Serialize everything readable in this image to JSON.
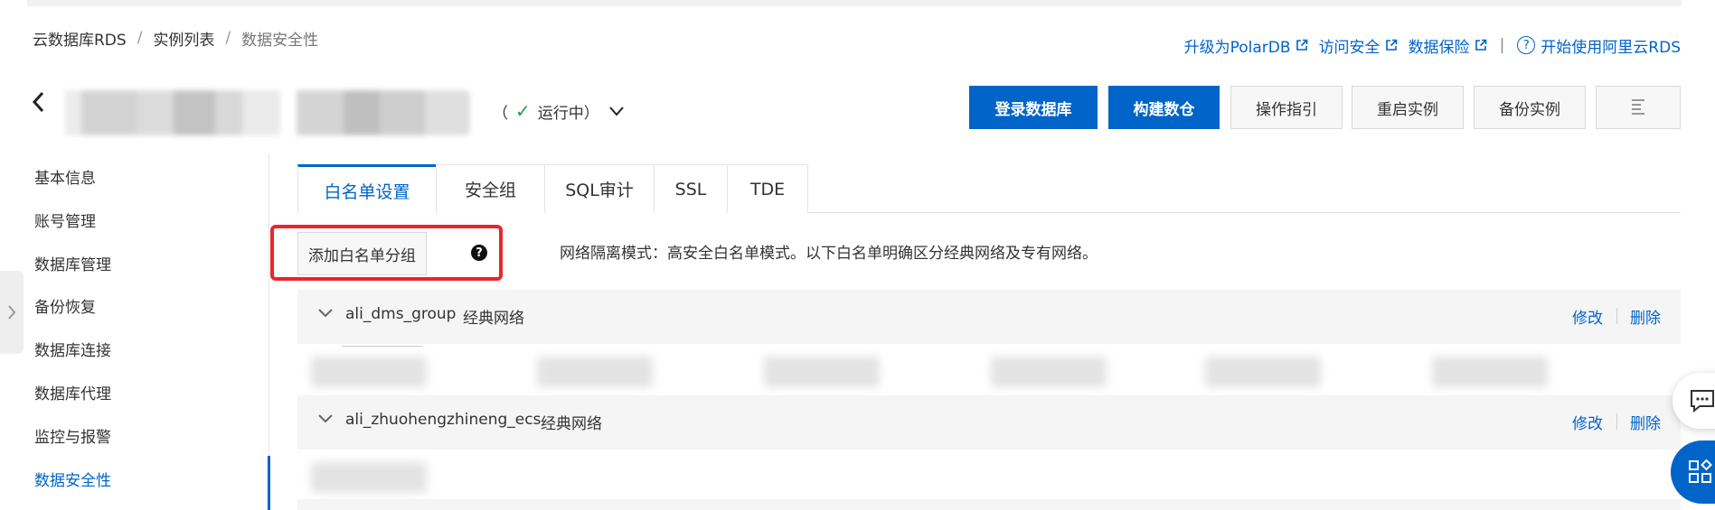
{
  "breadcrumb": {
    "items": [
      "云数据库RDS",
      "实例列表",
      "数据安全性"
    ],
    "separator": "/"
  },
  "top_links": {
    "upgrade": "升级为PolarDB",
    "access_security": "访问安全",
    "data_protection": "数据保险",
    "divider": "|",
    "help_icon_text": "?",
    "getting_started": "开始使用阿里云RDS"
  },
  "instance": {
    "status_open": "（",
    "status_text": "运行中",
    "status_close": "）"
  },
  "actions": {
    "login_db": "登录数据库",
    "build_dw": "构建数仓",
    "op_guide": "操作指引",
    "restart": "重启实例",
    "backup": "备份实例"
  },
  "sidebar": {
    "items": [
      {
        "label": "基本信息"
      },
      {
        "label": "账号管理"
      },
      {
        "label": "数据库管理"
      },
      {
        "label": "备份恢复"
      },
      {
        "label": "数据库连接"
      },
      {
        "label": "数据库代理"
      },
      {
        "label": "监控与报警"
      },
      {
        "label": "数据安全性"
      }
    ],
    "active_index": 7
  },
  "tabs": [
    {
      "label": "白名单设置",
      "active": true
    },
    {
      "label": "安全组"
    },
    {
      "label": "SQL审计"
    },
    {
      "label": "SSL"
    },
    {
      "label": "TDE"
    }
  ],
  "whitelist": {
    "add_group_label": "添加白名单分组",
    "help_icon_text": "?",
    "isolation_text": "网络隔离模式：高安全白名单模式。以下白名单明确区分经典网络及专有网络。",
    "groups": [
      {
        "name": "ali_dms_group",
        "network": "经典网络",
        "edit": "修改",
        "delete": "删除"
      },
      {
        "name": "ali_zhuohengzhineng_ecs",
        "network": "经典网络",
        "edit": "修改",
        "delete": "删除"
      }
    ]
  },
  "colors": {
    "accent": "#0064c8",
    "highlight_box": "#e8262c",
    "status_ok": "#1e9e3e"
  },
  "icons": [
    "back-arrow-icon",
    "external-link-icon",
    "help-circle-icon",
    "check-icon",
    "chevron-down-icon",
    "question-icon",
    "collapse-arrow-icon",
    "list-icon",
    "chat-icon",
    "apps-icon"
  ]
}
